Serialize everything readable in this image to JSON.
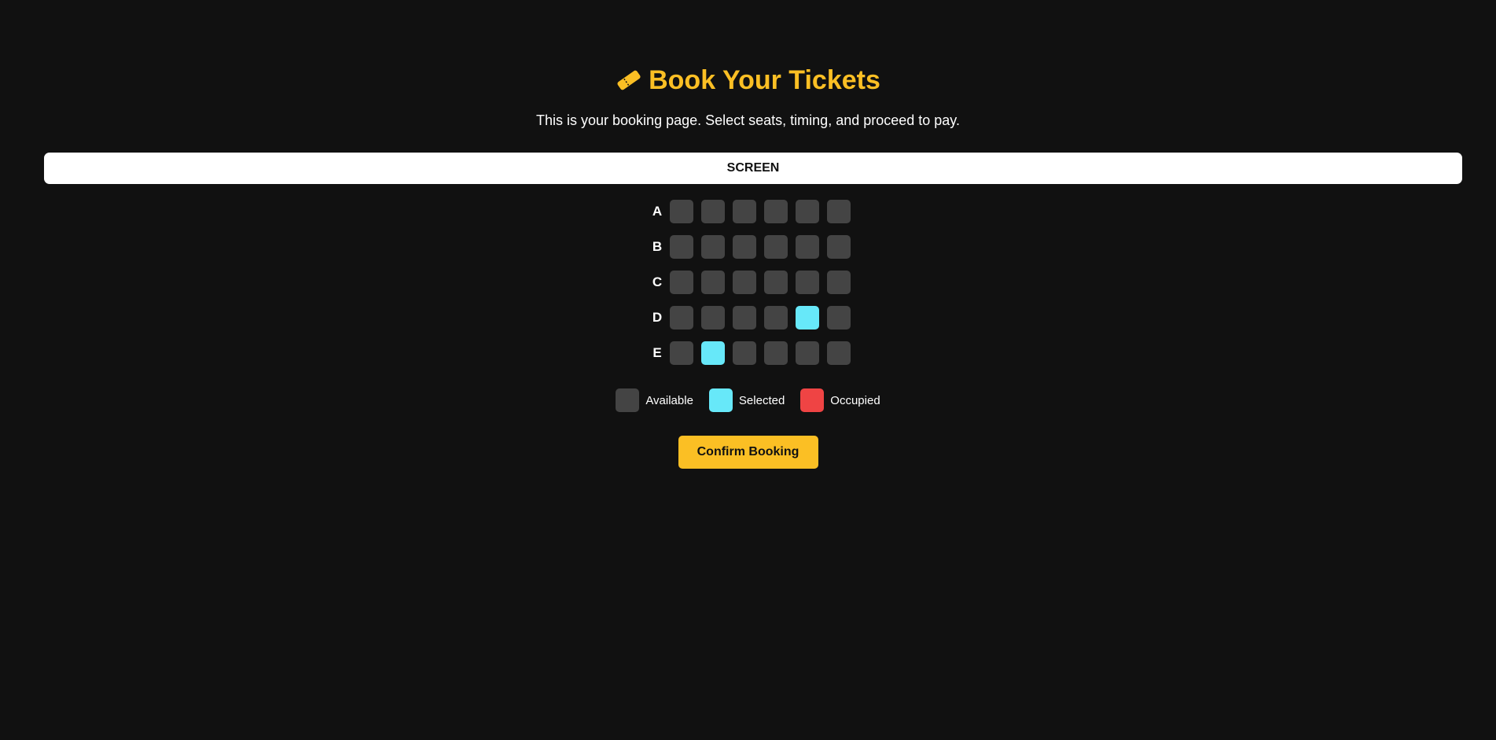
{
  "page": {
    "title_icon": "ticket-icon",
    "title": "Book Your Tickets",
    "subtitle": "This is your booking page. Select seats, timing, and proceed to pay."
  },
  "screen": {
    "label": "SCREEN"
  },
  "seat_map": {
    "rows": [
      {
        "label": "A",
        "seats": [
          "available",
          "available",
          "available",
          "available",
          "available",
          "available"
        ]
      },
      {
        "label": "B",
        "seats": [
          "available",
          "available",
          "available",
          "available",
          "available",
          "available"
        ]
      },
      {
        "label": "C",
        "seats": [
          "available",
          "available",
          "available",
          "available",
          "available",
          "available"
        ]
      },
      {
        "label": "D",
        "seats": [
          "available",
          "available",
          "available",
          "available",
          "selected",
          "available"
        ]
      },
      {
        "label": "E",
        "seats": [
          "available",
          "selected",
          "available",
          "available",
          "available",
          "available"
        ]
      }
    ]
  },
  "legend": [
    {
      "status": "available",
      "label": "Available",
      "color": "#444444"
    },
    {
      "status": "selected",
      "label": "Selected",
      "color": "#67e8f9"
    },
    {
      "status": "occupied",
      "label": "Occupied",
      "color": "#ef4444"
    }
  ],
  "actions": {
    "confirm_label": "Confirm Booking"
  },
  "colors": {
    "background": "#111111",
    "accent": "#fbbf24",
    "seat_available": "#444444",
    "seat_selected": "#67e8f9",
    "seat_occupied": "#ef4444"
  }
}
